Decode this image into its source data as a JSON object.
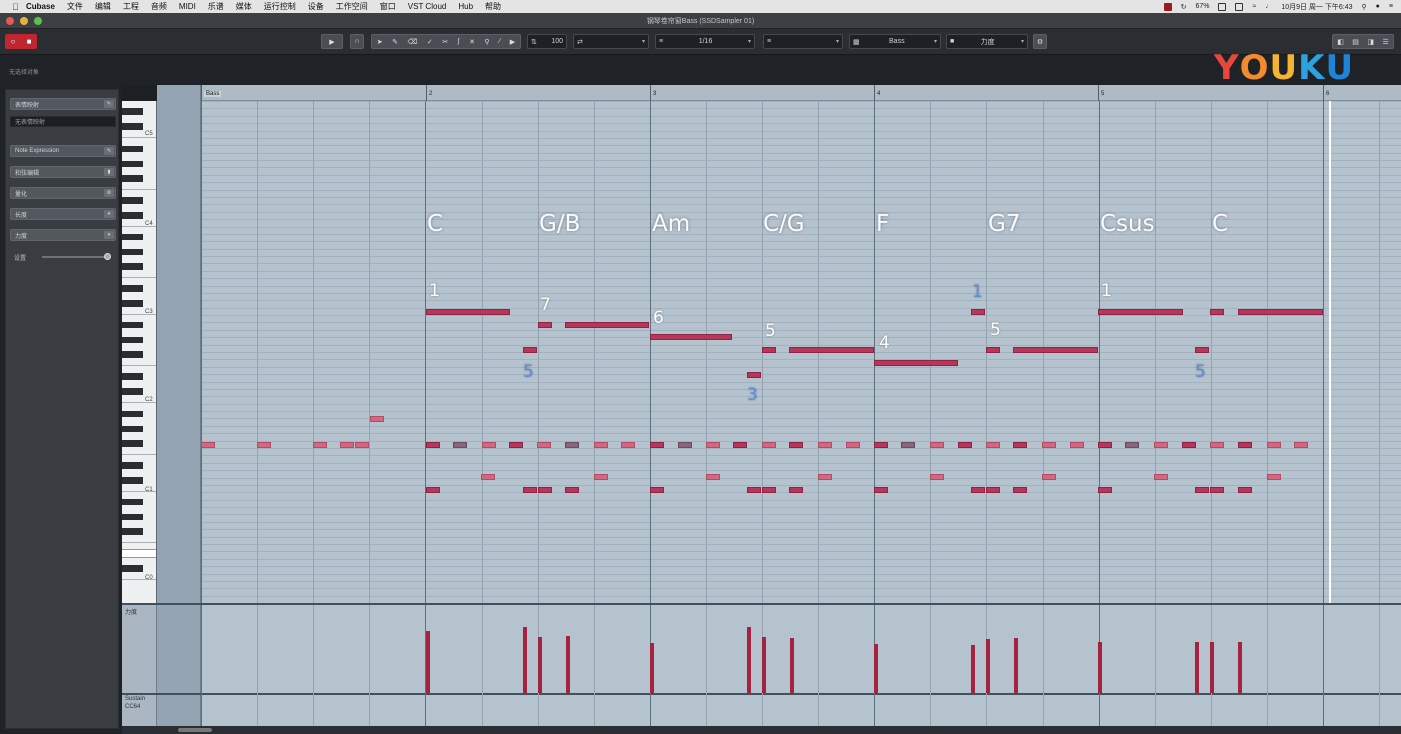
{
  "menubar": {
    "app": "Cubase",
    "items": [
      "文件",
      "编辑",
      "工程",
      "音频",
      "MIDI",
      "乐谱",
      "媒体",
      "运行控制",
      "设备",
      "工作空间",
      "窗口",
      "VST Cloud",
      "Hub",
      "帮助"
    ],
    "battery": "67%",
    "datetime": "10月9日 周一 下午6:43"
  },
  "window": {
    "title": "钢琴卷帘窗Bass (SSDSampler 01)"
  },
  "toolbar": {
    "quantize": "1/16",
    "insert_velocity": "100",
    "scale_label": "Bass",
    "color_label": "力度"
  },
  "infoline": {
    "label": "无选择对象"
  },
  "watermark": {
    "letters": [
      "Y",
      "O",
      "U",
      "K",
      "U"
    ],
    "colors": [
      "#e8483b",
      "#f28a2e",
      "#f3b431",
      "#2aa3e0",
      "#1e84d6"
    ]
  },
  "inspector": {
    "rows": [
      {
        "label": "表情映射",
        "badge": ""
      },
      {
        "label": "无表情映射",
        "badge": "",
        "type": "field"
      },
      {
        "label": "Note Expression",
        "badge": ""
      },
      {
        "label": "和弦编辑",
        "badge": ""
      },
      {
        "label": "量化",
        "badge": ""
      },
      {
        "label": "长度",
        "badge": ""
      },
      {
        "label": "力度",
        "badge": ""
      }
    ],
    "slider_label": "设置"
  },
  "keyboard": {
    "labels": [
      "C5",
      "C4",
      "C3",
      "C2",
      "C1",
      "C0"
    ]
  },
  "ruler": {
    "part_name": "Bass",
    "bars": [
      "1",
      "2",
      "3",
      "4",
      "5",
      "6"
    ]
  },
  "chords": [
    "C",
    "G/B",
    "Am",
    "C/G",
    "F",
    "G7",
    "Csus",
    "C"
  ],
  "degrees": [
    {
      "text": "1",
      "color": "w"
    },
    {
      "text": "7",
      "color": "w"
    },
    {
      "text": "5",
      "color": "b"
    },
    {
      "text": "6",
      "color": "w"
    },
    {
      "text": "5",
      "color": "w"
    },
    {
      "text": "3",
      "color": "b"
    },
    {
      "text": "4",
      "color": "w"
    },
    {
      "text": "1",
      "color": "b"
    },
    {
      "text": "5",
      "color": "w"
    },
    {
      "text": "1",
      "color": "w"
    },
    {
      "text": "5",
      "color": "b"
    }
  ],
  "controller": {
    "lane1_label": "力度",
    "lane2_label": "Sustain",
    "lane2_sub": "CC64"
  }
}
